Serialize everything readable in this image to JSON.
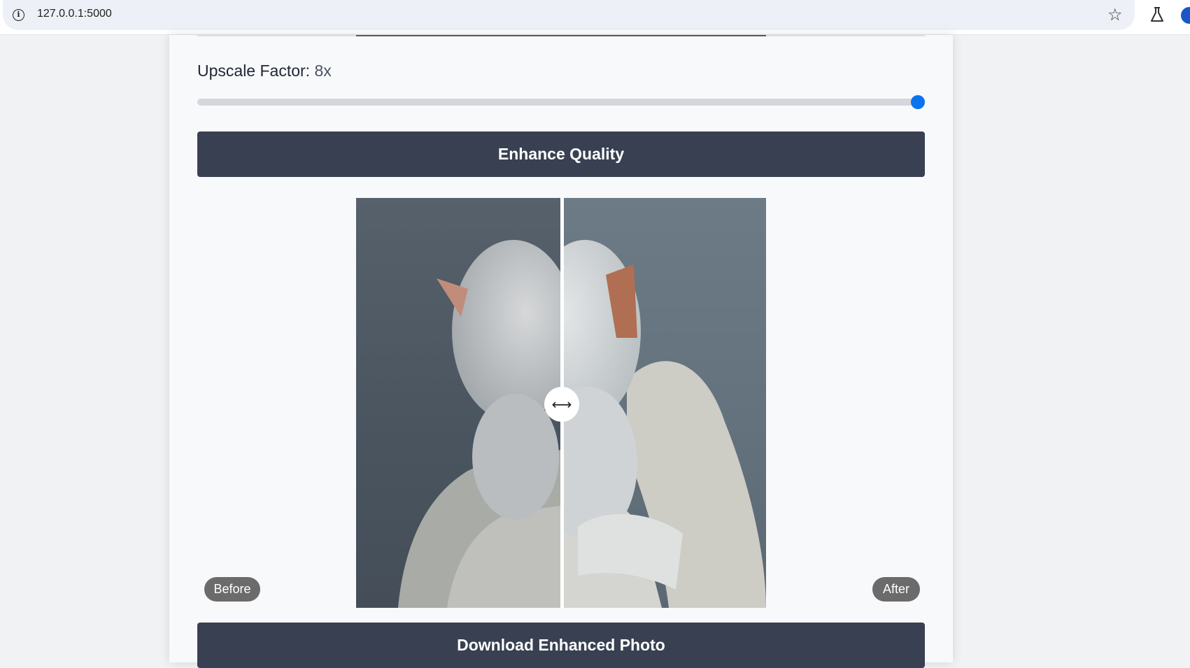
{
  "browser": {
    "url": "127.0.0.1:5000",
    "icons": {
      "info": "info-icon",
      "star": "star-icon",
      "lab": "lab-icon",
      "profile": "profile-icon"
    }
  },
  "upscale": {
    "label": "Upscale Factor:",
    "value_text": "8x",
    "slider_level": 1.0
  },
  "enhance": {
    "button_label": "Enhance Quality"
  },
  "compare": {
    "before_label": "Before",
    "after_label": "After",
    "handle_glyph": "⟷"
  },
  "download": {
    "button_label": "Download Enhanced Photo"
  },
  "colors": {
    "accent": "#0a74f0",
    "button_bg": "#384051",
    "tag_bg": "#6b6b6b"
  }
}
